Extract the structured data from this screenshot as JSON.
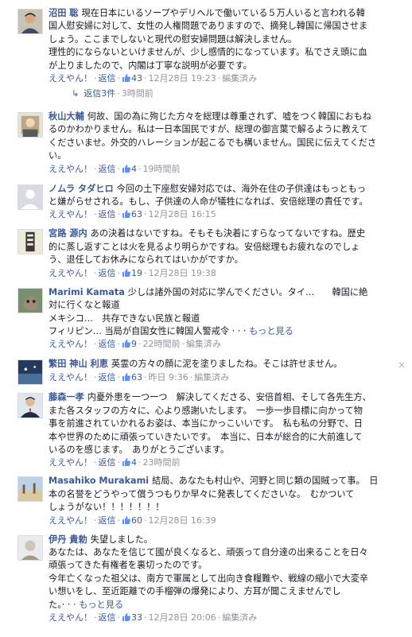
{
  "ui": {
    "like": "ええやん！",
    "reply": "返信",
    "edit_history": "編集済み",
    "more": "もっと見る",
    "dot": "·"
  },
  "comments": [
    {
      "author": "沼田 聡",
      "lines": [
        "現在日本にいるソープやデリヘルで働いている５万人いると言われる韓",
        "国人慰安婦に対して、女性の人権問題でありますので、摘発し韓国に帰国させま",
        "しょう。ここまでしないと現代の慰安婦問題は解決しません。",
        "理性的にならないといけませんが、少し感情的になっています。私でさえ頭に血",
        "が上りましたので、内閣は丁寧な説明が必要です。"
      ],
      "likes": "43",
      "time": "12月28日 19:23",
      "edited": true,
      "replies": {
        "label": "返信3件",
        "time": "3時間前"
      }
    },
    {
      "author": "秋山大輔",
      "lines": [
        "何故、国の為に殉じた方々を総理は尊重されず、嘘をつく韓国におもね",
        "るのかわかりません。私は一日本国民ですが、総理の御言葉で解るように教えて",
        "くださいませ。外交的ハレーションが起こるでも構いません。国民に伝えてくださ",
        "い。"
      ],
      "likes": "4",
      "time": "19時間前",
      "edited": false
    },
    {
      "author": "ノムラ タダヒロ",
      "lines": [
        "今回の土下座慰安婦対応では、海外在住の子供達はもっともっ",
        "と嫌がらせされる。もし、子供達の人命が犠牲になれば、安倍総理の責任です。"
      ],
      "likes": "63",
      "time": "12月28日 16:15",
      "edited": false
    },
    {
      "author": "宮路 源内",
      "lines": [
        "あの決着はないですね。そもそも決着にすらなってないですね。歴史",
        "的に蒸し返すことは火を見るより明らかですね。安倍総理もお疲れなのでしょ",
        "う、退任してお休みになられてはいかがですか。"
      ],
      "likes": "19",
      "time": "12月28日 19:38",
      "edited": false
    },
    {
      "author": "Marimi Kamata",
      "lines": [
        "少しは諸外国の対応に学んでください。タイ…　　韓国に絶",
        "対に行くなと報道",
        "メキシコ…　共存できない民族と報道",
        "フィリピン… 当局が自国女性に韓国人警戒令 · · ·"
      ],
      "has_more": true,
      "likes": "9",
      "time": "22時間前",
      "edited": true
    },
    {
      "author": "繁田 神山 利恵",
      "lines": [
        "英霊の方々の顔に泥を塗りましたね。そこは許せません。"
      ],
      "likes": "63",
      "time": "昨日 9:36",
      "edited": true,
      "close": "×"
    },
    {
      "author": "藤森一孝",
      "lines": [
        "内憂外患を一つ一つ　解決してくださる、安倍首相、そして各先生方、",
        "また各スタッフの方々に、心より感謝いたします。　一歩一歩目標に向かって物",
        "事を前進されていかれるお姿は、本当にかっこいいです。　私も私の分野で、日",
        "本や世界のために頑張っていきたいです。　本当に、日本が総合的に大前進して",
        "いるのを感じます。　ありがとうございます。"
      ],
      "likes": "4",
      "time": "23時間前",
      "edited": false
    },
    {
      "author": "Masahiko Murakami",
      "lines": [
        "結局、あなたも村山や、河野と同じ類の国賊って事。　日",
        "本の名誉をどうやって償うつもりか早々に発表してくださいな。　むかついて",
        "しょうがない！！！！！！！"
      ],
      "likes": "60",
      "time": "12月28日 16:39",
      "edited": false
    },
    {
      "author": "伊丹 貴勅",
      "lines": [
        "失望しました。",
        "あなたは、あなたを信じて國が良くなると、頑張って自分達の出来ることを日々",
        "頑張ってきた有権者を裏切ったのです。",
        "今年亡くなった祖父は、南方で軍属として出向き食糧難や、戦線の縮小で大変辛",
        "い想いをし、至近距離での手榴弾の爆発により、方耳が聞こえませんでし",
        "た。· · ·"
      ],
      "has_more": true,
      "likes": "33",
      "time": "12月28日 20:06",
      "edited": true
    }
  ]
}
